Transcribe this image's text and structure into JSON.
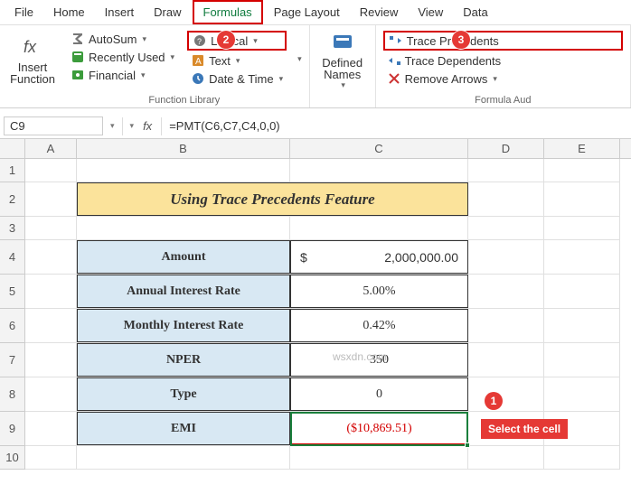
{
  "menu": {
    "tabs": [
      "File",
      "Home",
      "Insert",
      "Draw",
      "Formulas",
      "Page Layout",
      "Review",
      "View",
      "Data"
    ],
    "active": "Formulas"
  },
  "ribbon": {
    "insert_function": "Insert\nFunction",
    "function_library": {
      "label": "Function Library",
      "autosum": "AutoSum",
      "recently_used": "Recently Used",
      "financial": "Financial",
      "logical": "Logical",
      "text": "Text",
      "date_time": "Date & Time"
    },
    "defined_names": {
      "label": "Defined\nNames"
    },
    "formula_auditing": {
      "label": "Formula Aud",
      "trace_precedents": "Trace Precedents",
      "trace_dependents": "Trace Dependents",
      "remove_arrows": "Remove Arrows"
    }
  },
  "callouts": {
    "c1": "1",
    "c2": "2",
    "c3": "3",
    "select_cell": "Select the cell"
  },
  "formula_bar": {
    "name_box": "C9",
    "fx": "fx",
    "formula": "=PMT(C6,C7,C4,0,0)"
  },
  "columns": [
    "A",
    "B",
    "C",
    "D",
    "E"
  ],
  "rows": [
    "1",
    "2",
    "3",
    "4",
    "5",
    "6",
    "7",
    "8",
    "9",
    "10"
  ],
  "table": {
    "title": "Using Trace Precedents Feature",
    "r4": {
      "label": "Amount",
      "currency": "$",
      "value": "2,000,000.00"
    },
    "r5": {
      "label": "Annual Interest Rate",
      "value": "5.00%"
    },
    "r6": {
      "label": "Monthly Interest Rate",
      "value": "0.42%"
    },
    "r7": {
      "label": "NPER",
      "value": "350"
    },
    "r8": {
      "label": "Type",
      "value": "0"
    },
    "r9": {
      "label": "EMI",
      "value": "($10,869.51)"
    }
  },
  "watermark": "wsxdn.com"
}
